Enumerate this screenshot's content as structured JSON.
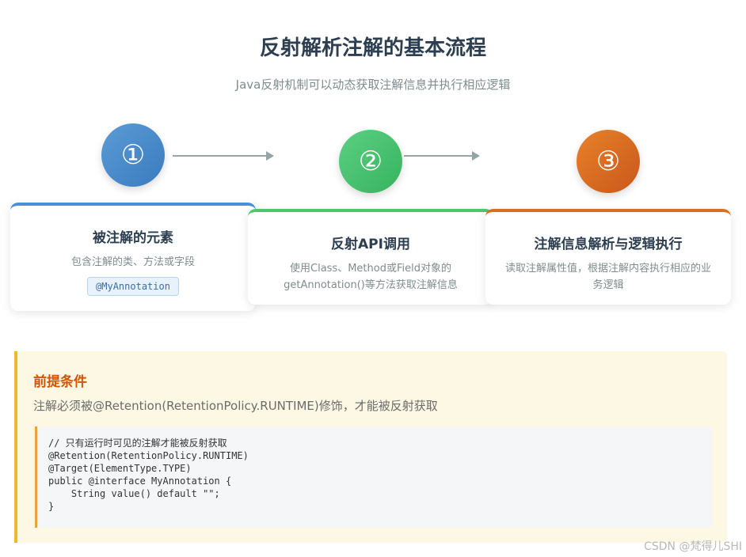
{
  "header": {
    "title": "反射解析注解的基本流程",
    "subtitle": "Java反射机制可以动态获取注解信息并执行相应逻辑"
  },
  "steps": [
    {
      "number": "①",
      "title": "被注解的元素",
      "desc": "包含注解的类、方法或字段",
      "tag": "@MyAnnotation",
      "color": "#4a90d9"
    },
    {
      "number": "②",
      "title": "反射API调用",
      "desc": "使用Class、Method或Field对象的getAnnotation()等方法获取注解信息",
      "color": "#4cc76f"
    },
    {
      "number": "③",
      "title": "注解信息解析与逻辑执行",
      "desc": "读取注解属性值，根据注解内容执行相应的业务逻辑",
      "color": "#d96f22"
    }
  ],
  "prerequisite": {
    "title": "前提条件",
    "text": "注解必须被@Retention(RetentionPolicy.RUNTIME)修饰，才能被反射获取",
    "code": "// 只有运行时可见的注解才能被反射获取\n@Retention(RetentionPolicy.RUNTIME)\n@Target(ElementType.TYPE)\npublic @interface MyAnnotation {\n    String value() default \"\";\n}"
  },
  "watermark": "CSDN @梵得儿SHI"
}
